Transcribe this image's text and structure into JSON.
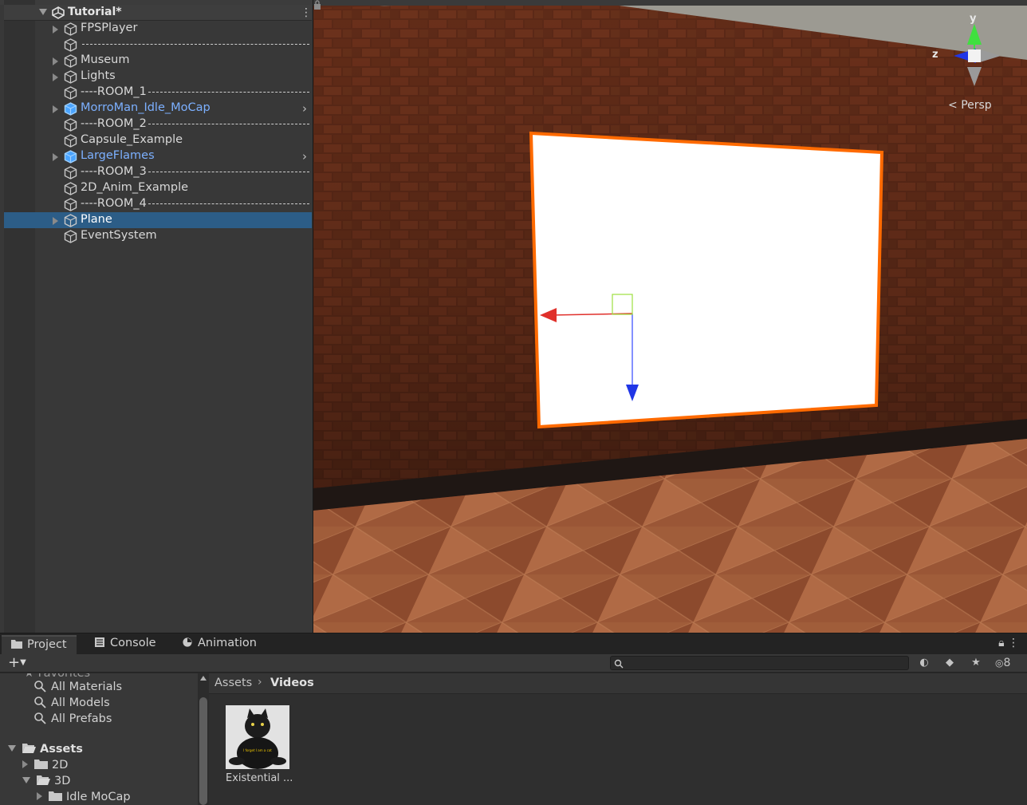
{
  "hierarchy": {
    "scene_title": "Tutorial*",
    "items": [
      {
        "label": "FPSPlayer",
        "foldable": true,
        "prefab": false,
        "dashes": false,
        "selected": false,
        "arrow": false
      },
      {
        "label": "",
        "foldable": false,
        "prefab": false,
        "dashes": true,
        "selected": false,
        "arrow": false
      },
      {
        "label": "Museum",
        "foldable": true,
        "prefab": false,
        "dashes": false,
        "selected": false,
        "arrow": false
      },
      {
        "label": "Lights",
        "foldable": true,
        "prefab": false,
        "dashes": false,
        "selected": false,
        "arrow": false
      },
      {
        "label": "----ROOM_1",
        "foldable": false,
        "prefab": false,
        "dashes": true,
        "selected": false,
        "arrow": false
      },
      {
        "label": "MorroMan_Idle_MoCap",
        "foldable": true,
        "prefab": true,
        "dashes": false,
        "selected": false,
        "arrow": true
      },
      {
        "label": "----ROOM_2",
        "foldable": false,
        "prefab": false,
        "dashes": true,
        "selected": false,
        "arrow": false
      },
      {
        "label": "Capsule_Example",
        "foldable": false,
        "prefab": false,
        "dashes": false,
        "selected": false,
        "arrow": false
      },
      {
        "label": "LargeFlames",
        "foldable": true,
        "prefab": true,
        "dashes": false,
        "selected": false,
        "arrow": true
      },
      {
        "label": "----ROOM_3",
        "foldable": false,
        "prefab": false,
        "dashes": true,
        "selected": false,
        "arrow": false
      },
      {
        "label": "2D_Anim_Example",
        "foldable": false,
        "prefab": false,
        "dashes": false,
        "selected": false,
        "arrow": false
      },
      {
        "label": "----ROOM_4",
        "foldable": false,
        "prefab": false,
        "dashes": true,
        "selected": false,
        "arrow": false
      },
      {
        "label": "Plane",
        "foldable": true,
        "prefab": false,
        "dashes": false,
        "selected": true,
        "arrow": false
      },
      {
        "label": "EventSystem",
        "foldable": false,
        "prefab": false,
        "dashes": false,
        "selected": false,
        "arrow": false
      }
    ]
  },
  "scene_view": {
    "axis_y": "y",
    "axis_z": "z",
    "projection": "Persp",
    "selection_color": "#ff6a00"
  },
  "bottom": {
    "tabs": [
      {
        "label": "Project",
        "icon": "folder-icon",
        "active": true
      },
      {
        "label": "Console",
        "icon": "console-icon",
        "active": false
      },
      {
        "label": "Animation",
        "icon": "animation-icon",
        "active": false
      }
    ],
    "hidden_count": "8",
    "favorites": [
      "All Materials",
      "All Models",
      "All Prefabs"
    ],
    "tree": {
      "root": "Assets",
      "children": [
        "2D",
        "3D"
      ],
      "grandchild": "Idle MoCap"
    },
    "breadcrumb": [
      "Assets",
      "Videos"
    ],
    "assets": [
      {
        "label": "Existential ...",
        "thumb_caption": "I forget I am a cat"
      }
    ]
  }
}
